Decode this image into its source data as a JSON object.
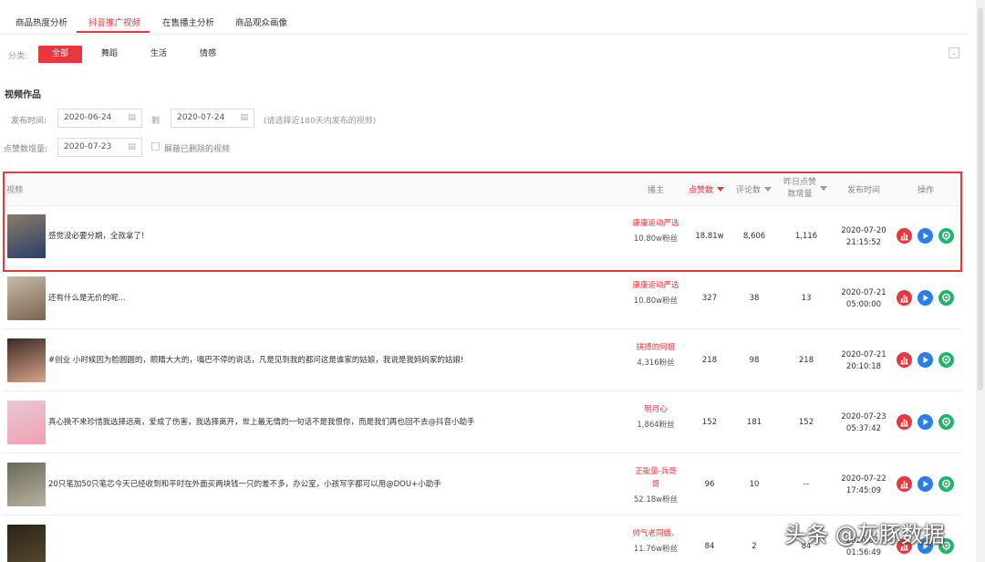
{
  "tabs": [
    {
      "label": "商品热度分析",
      "active": false
    },
    {
      "label": "抖音推广视频",
      "active": true
    },
    {
      "label": "在售播主分析",
      "active": false
    },
    {
      "label": "商品观众画像",
      "active": false
    }
  ],
  "category": {
    "label": "分类:",
    "options": [
      {
        "label": "全部",
        "active": true
      },
      {
        "label": "舞蹈",
        "active": false
      },
      {
        "label": "生活",
        "active": false
      },
      {
        "label": "情感",
        "active": false
      }
    ],
    "collapse_icon": "chevron-down-icon"
  },
  "section_title": "视频作品",
  "filters": {
    "publish_time_label": "发布时间:",
    "start_date": "2020-06-24",
    "to_label": "到",
    "end_date": "2020-07-24",
    "hint": "(请选择近180天内发布的视频)",
    "likes_growth_label": "点赞数增量:",
    "likes_growth_date": "2020-07-23",
    "hide_deleted_label": "屏蔽已删除的视频",
    "hide_deleted_checked": false
  },
  "table": {
    "headers": {
      "video": "视频",
      "anchor": "播主",
      "likes": "点赞数",
      "comments": "评论数",
      "likes_yesterday_line1": "昨日点赞",
      "likes_yesterday_line2": "数增量",
      "publish_time": "发布时间",
      "actions": "操作"
    },
    "rows": [
      {
        "title": "感觉没必要分期，全款拿了!",
        "anchor": "康康运动严选",
        "fans": "10.80w粉丝",
        "likes": "18.81w",
        "comments": "8,606",
        "likes_yesterday": "1,116",
        "date": "2020-07-20",
        "time": "21:15:52",
        "thumb_colors": [
          "#8a7a6a",
          "#2c3e6a"
        ]
      },
      {
        "title": "还有什么是无价的呢...",
        "anchor": "康康运动严选",
        "fans": "10.80w粉丝",
        "likes": "327",
        "comments": "38",
        "likes_yesterday": "13",
        "date": "2020-07-21",
        "time": "05:00:00",
        "thumb_colors": [
          "#c8b9a8",
          "#7a6550"
        ]
      },
      {
        "title": "#创业 小时候因为脸圆圆的，眼睛大大的，嘴巴不停的说话，凡是见到我的都问这是谁家的姑娘，我说是我妈妈家的姑娘!",
        "anchor": "拼搏的何姐",
        "fans": "4,316粉丝",
        "likes": "218",
        "comments": "98",
        "likes_yesterday": "218",
        "date": "2020-07-21",
        "time": "20:10:18",
        "thumb_colors": [
          "#3a2a22",
          "#d9a48a"
        ]
      },
      {
        "title": "真心换不来珍惜我选择远离，爱成了伤害，我选择离开，世上最无情的一句话不是我恨你，而是我们再也回不去@抖音小助手",
        "anchor": "明月心",
        "fans": "1,864粉丝",
        "likes": "152",
        "comments": "181",
        "likes_yesterday": "152",
        "date": "2020-07-23",
        "time": "05:37:42",
        "thumb_colors": [
          "#e8c8d8",
          "#f0a0b0"
        ]
      },
      {
        "title": "20只笔加50只笔芯今天已经收到和平时在外面买两块钱一只的差不多，办公室，小孩写字都可以用@DOU+小助手",
        "anchor": "正能量-兵哥哥",
        "fans": "52.18w粉丝",
        "likes": "96",
        "comments": "10",
        "likes_yesterday": "--",
        "date": "2020-07-22",
        "time": "17:45:09",
        "thumb_colors": [
          "#6a6a5a",
          "#b8b0a0"
        ]
      },
      {
        "title": "",
        "anchor": "帅气老同娥、",
        "fans": "11.76w粉丝",
        "likes": "84",
        "comments": "2",
        "likes_yesterday": "84",
        "date": "2020-07-",
        "time": "01:56:49",
        "thumb_colors": [
          "#2a2418",
          "#5a4a30"
        ]
      }
    ]
  },
  "watermark": "头条 @灰豚数据",
  "colors": {
    "accent": "#e8383d",
    "op_red": "#e8383d",
    "op_blue": "#2b7de9",
    "op_green": "#1fb36b"
  }
}
